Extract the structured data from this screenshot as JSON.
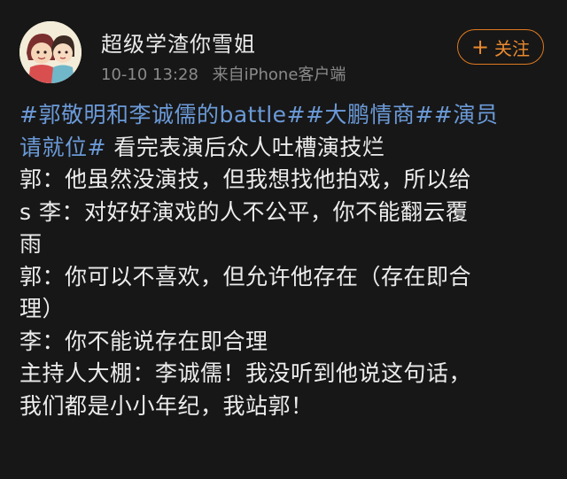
{
  "user": {
    "name": "超级学渣你雪姐",
    "time": "10-10 13:28",
    "source": "来自iPhone客户端"
  },
  "actions": {
    "follow_label": "关注"
  },
  "post": {
    "hashtags": [
      "#郭敬明和李诚儒的battle#",
      "#大鹏情商#",
      "#演员请就位#"
    ],
    "intro": " 看完表演后众人吐槽演技烂",
    "lines": [
      "郭：他虽然没演技，但我想找他拍戏，所以给",
      "s 李：对好好演戏的人不公平，你不能翻云覆",
      "雨",
      "郭：你可以不喜欢，但允许他存在（存在即合",
      "理）",
      "李：你不能说存在即合理",
      "主持人大棚：李诚儒！我没听到他说这句话，",
      "我们都是小小年纪，我站郭！"
    ]
  },
  "colors": {
    "background": "#171717",
    "hashtag": "#6b9ad8",
    "follow_accent": "#e07a1f",
    "meta_text": "#8a8a8a"
  },
  "icons": {
    "follow": "plus-icon"
  }
}
